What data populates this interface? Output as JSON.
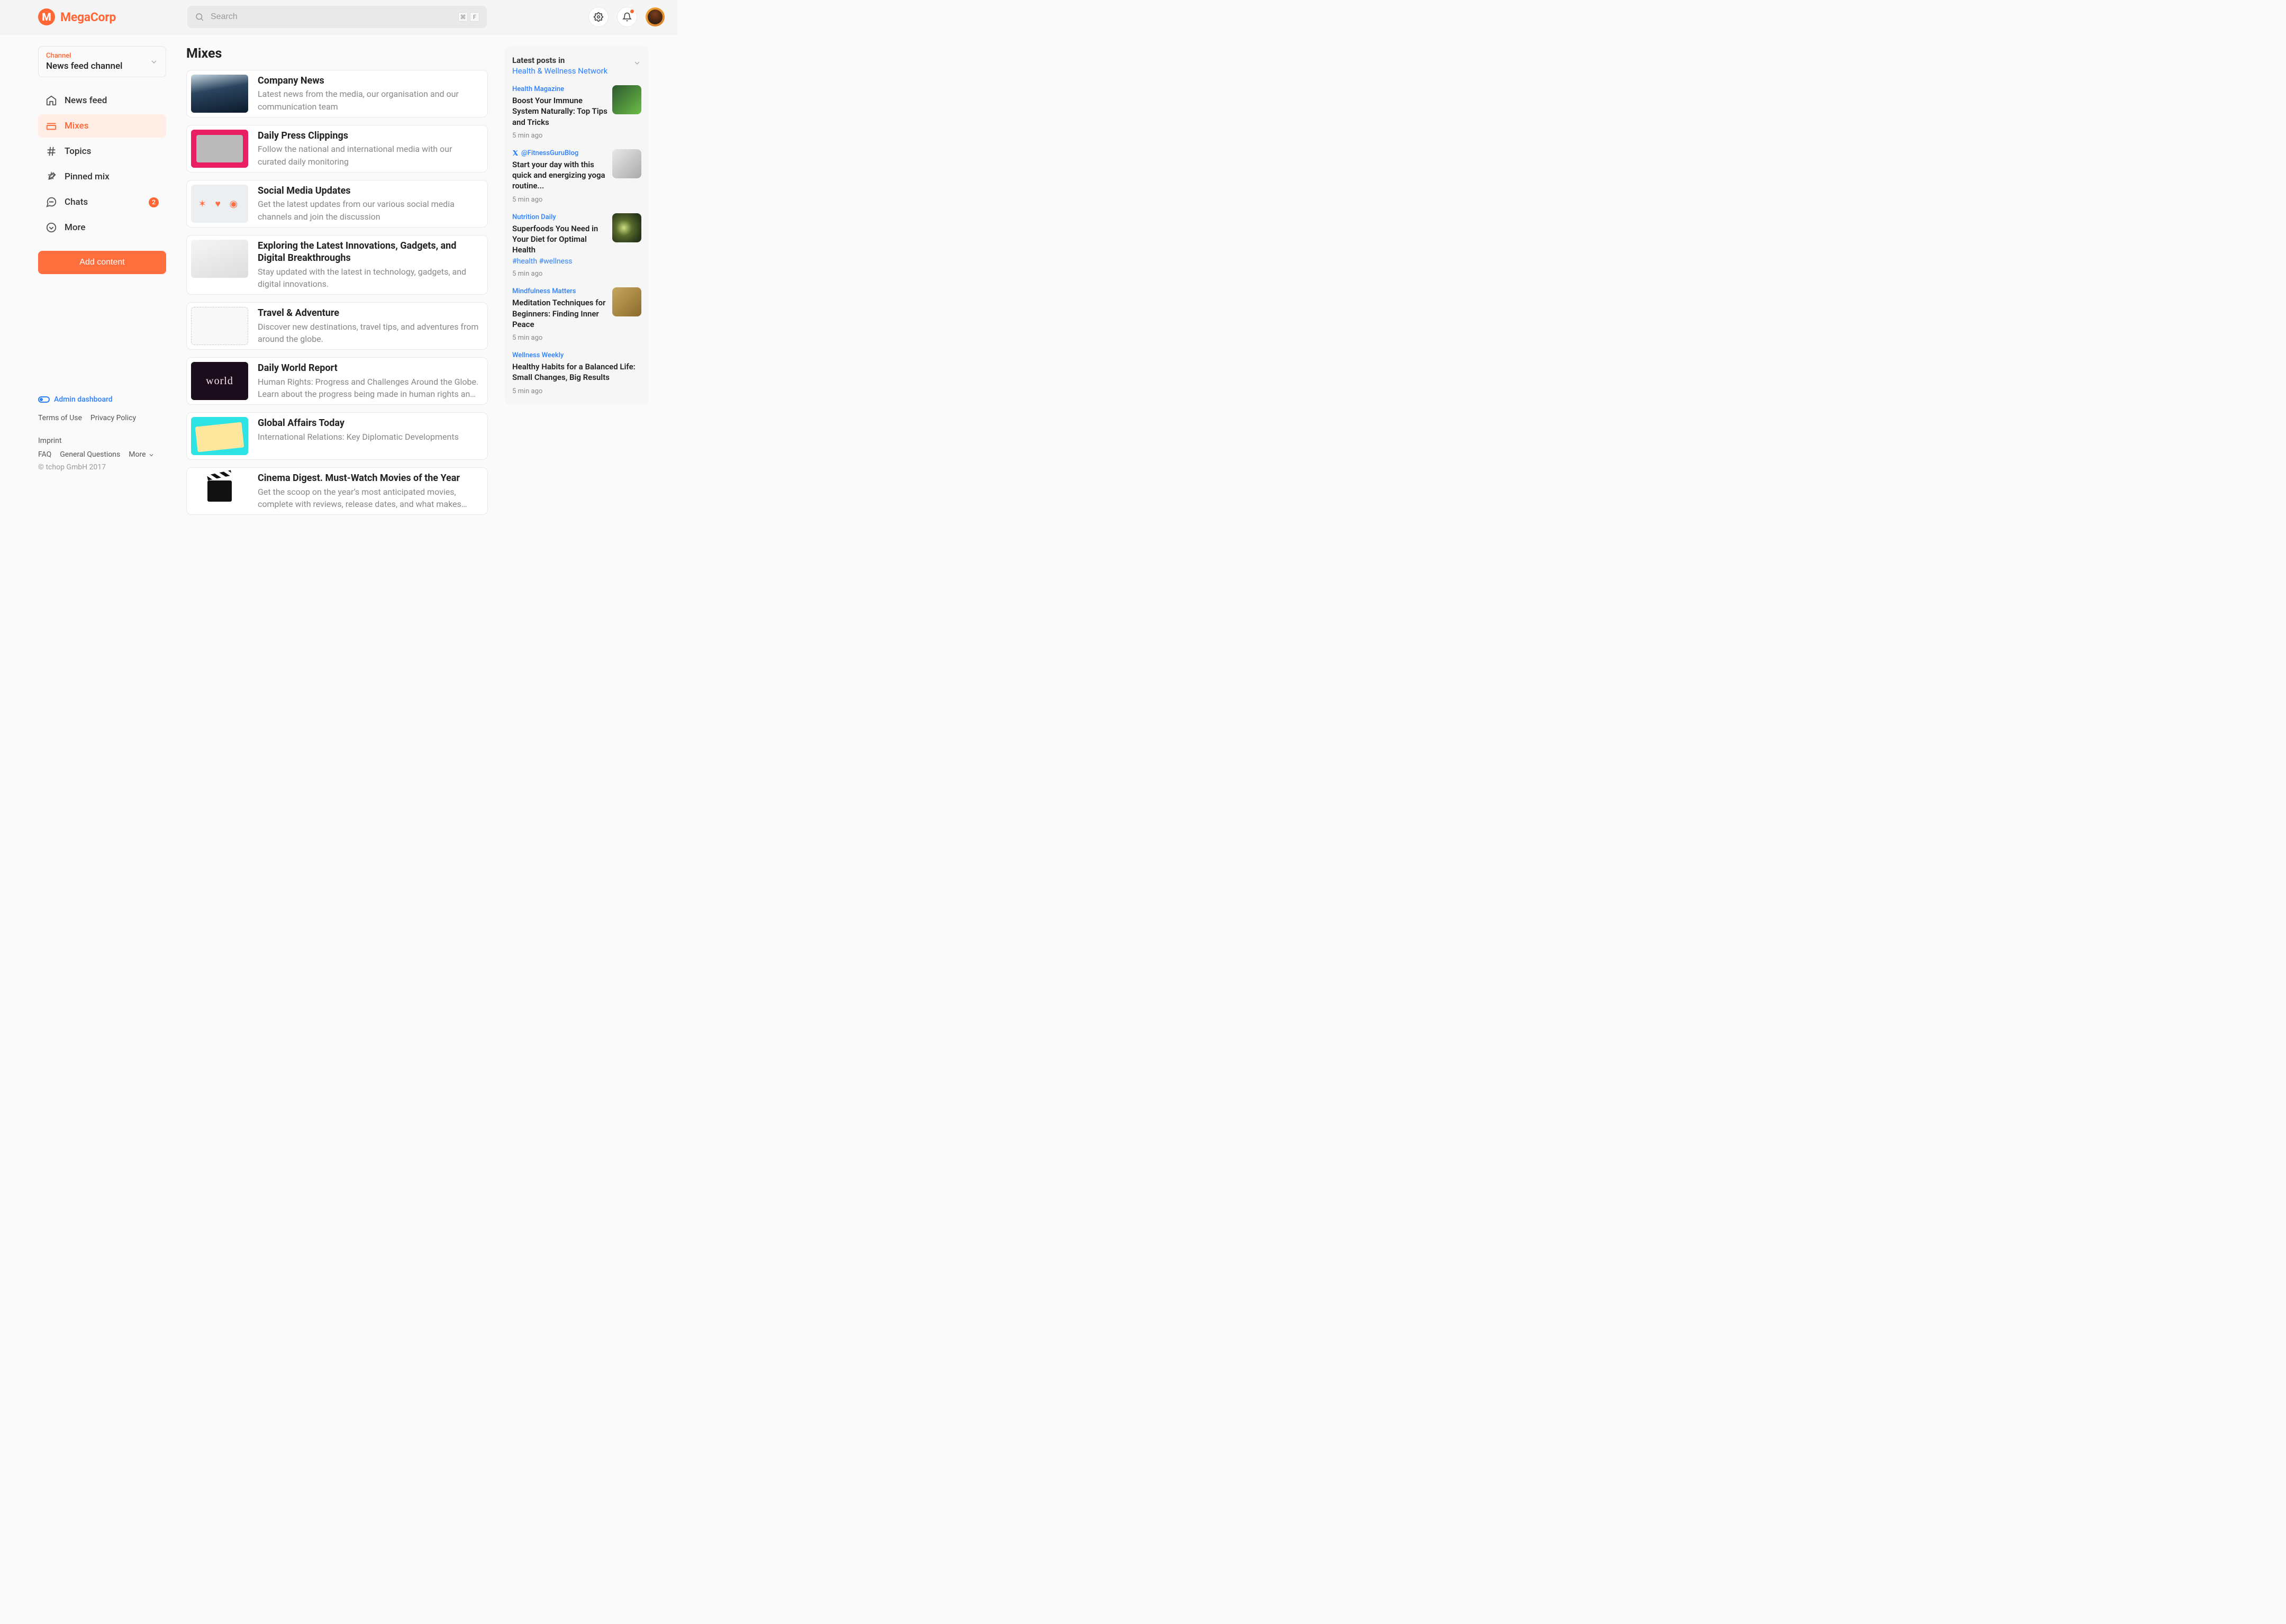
{
  "header": {
    "brand_letter": "M",
    "brand": "MegaCorp",
    "search_placeholder": "Search",
    "shortcut": {
      "k1": "⌘",
      "k2": "F"
    }
  },
  "channel": {
    "label": "Channel",
    "value": "News feed channel"
  },
  "nav": {
    "news_feed": "News feed",
    "mixes": "Mixes",
    "topics": "Topics",
    "pinned_mix": "Pinned mix",
    "chats": "Chats",
    "chats_badge": "2",
    "more": "More"
  },
  "add_button": "Add content",
  "page_title": "Mixes",
  "mixes": [
    {
      "title": "Company News",
      "desc": "Latest news from the media, our organisation and our communication team"
    },
    {
      "title": "Daily Press Clippings",
      "desc": "Follow the national and international media with our curated daily monitoring"
    },
    {
      "title": "Social Media Updates",
      "desc": "Get the latest updates from our various social media channels and join the discussion"
    },
    {
      "title": "Exploring the Latest Innovations, Gadgets, and Digital Breakthroughs",
      "desc": "Stay updated with the latest in technology, gadgets, and digital innovations."
    },
    {
      "title": "Travel & Adventure",
      "desc": "Discover new destinations, travel tips, and adventures from around the globe."
    },
    {
      "title": "Daily World Report",
      "desc": "Human Rights: Progress and Challenges Around the Globe. Learn about the progress being made in human rights and th..."
    },
    {
      "title": "Global Affairs Today",
      "desc": "International Relations: Key Diplomatic Developments"
    },
    {
      "title": "Cinema Digest. Must-Watch Movies of the Year",
      "desc": "Get the scoop on the year’s most anticipated movies, complete with reviews, release dates, and what makes them a must-"
    }
  ],
  "latest": {
    "label": "Latest posts in",
    "source": "Health & Wellness Network",
    "posts": [
      {
        "src": "Health Magazine",
        "title": "Boost Your Immune System Naturally: Top Tips and Tricks",
        "time": "5 min ago",
        "thumb": true,
        "icon": false
      },
      {
        "src": "@FitnessGuruBlog",
        "title": "Start your day with this quick and energizing yoga routine...",
        "time": "5 min ago",
        "thumb": true,
        "icon": true
      },
      {
        "src": "Nutrition Daily",
        "title": "Superfoods You Need in Your Diet for Optimal Health",
        "hash": "#health #wellness",
        "time": "5 min ago",
        "thumb": true,
        "icon": false
      },
      {
        "src": "Mindfulness Matters",
        "title": "Meditation Techniques for Beginners: Finding Inner Peace",
        "time": "5 min ago",
        "thumb": true,
        "icon": false
      },
      {
        "src": "Wellness Weekly",
        "title": "Healthy Habits for a Balanced Life: Small Changes, Big Results",
        "time": "5 min ago",
        "thumb": false,
        "icon": false
      }
    ]
  },
  "footer": {
    "admin": "Admin dashboard",
    "legal1": [
      "Terms of Use",
      "Privacy Policy",
      "Imprint"
    ],
    "legal2": [
      "FAQ",
      "General Questions",
      "More"
    ],
    "copyright": "© tchop GmbH 2017"
  }
}
